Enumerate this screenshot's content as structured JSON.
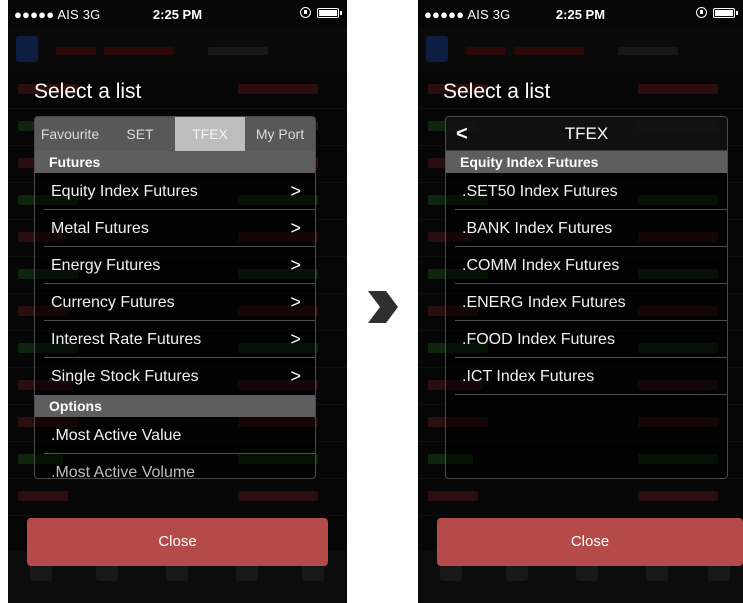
{
  "status_bar": {
    "carrier": "●●●●● AIS  3G",
    "time": "2:25 PM"
  },
  "left": {
    "title": "Select a list",
    "tabs": [
      {
        "label": "Favourite",
        "active": false
      },
      {
        "label": "SET",
        "active": false
      },
      {
        "label": "TFEX",
        "active": true
      },
      {
        "label": "My Port",
        "active": false
      }
    ],
    "futures_header": "Futures",
    "futures": [
      "Equity Index Futures",
      "Metal Futures",
      "Energy Futures",
      "Currency Futures",
      "Interest Rate Futures",
      "Single Stock Futures"
    ],
    "options_header": "Options",
    "options": [
      ".Most Active Value",
      ".Most Active Volume"
    ],
    "close_label": "Close"
  },
  "right": {
    "title": "Select a list",
    "nav_title": "TFEX",
    "section_header": "Equity Index Futures",
    "items": [
      ".SET50 Index Futures",
      ".BANK Index Futures",
      ".COMM Index Futures",
      ".ENERG Index Futures",
      ".FOOD Index Futures",
      ".ICT Index Futures"
    ],
    "close_label": "Close"
  },
  "colors": {
    "close_button": "#b54a4a",
    "active_tab": "#bdbdbd",
    "section_header": "#5e5e5e",
    "arrow": "#2f2f2f"
  },
  "icons": {
    "chevron": "chevron-right-icon",
    "back": "chevron-left-icon",
    "transition": "arrow-right-icon"
  }
}
